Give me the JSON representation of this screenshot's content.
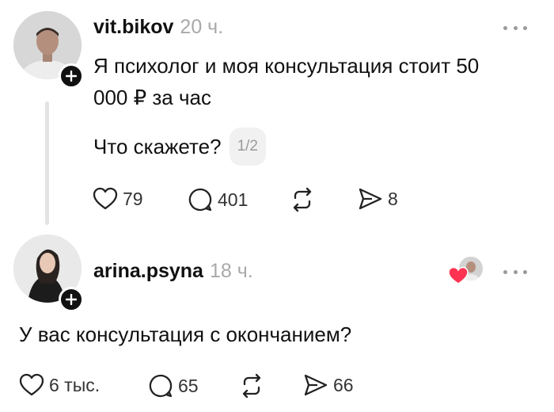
{
  "posts": [
    {
      "username": "vit.bikov",
      "time": "20 ч.",
      "text_line1": "Я психолог и моя консультация стоит 50",
      "text_line2": "000 ₽ за час",
      "text_line3": "Что скажете?",
      "page_indicator": "1/2",
      "likes": "79",
      "replies": "401",
      "shares": "8"
    },
    {
      "username": "arina.psyna",
      "time": "18 ч.",
      "text": "У вас консультация с окончанием?",
      "likes": "6 тыс.",
      "replies": "65",
      "shares": "66"
    }
  ],
  "icons": {
    "like": "heart-icon",
    "reply": "comment-bubble-icon",
    "repost": "repost-icon",
    "share": "send-icon",
    "follow": "plus-icon",
    "more": "more-horizontal-icon",
    "liked_by_author": "red-heart-icon"
  },
  "colors": {
    "accent_heart": "#fe3351",
    "muted": "#a9a9a9"
  }
}
